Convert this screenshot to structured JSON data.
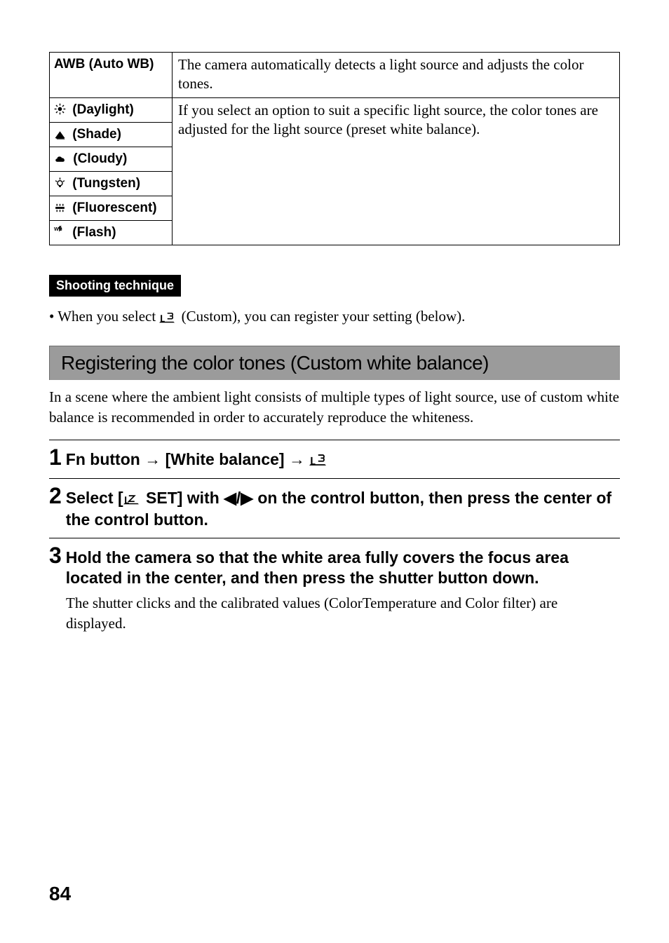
{
  "table": {
    "rows": [
      {
        "label": "AWB (Auto WB)",
        "icon": "none"
      },
      {
        "label": "(Daylight)",
        "icon": "sun"
      },
      {
        "label": "(Shade)",
        "icon": "shade"
      },
      {
        "label": "(Cloudy)",
        "icon": "cloud"
      },
      {
        "label": "(Tungsten)",
        "icon": "tungsten"
      },
      {
        "label": "(Fluorescent)",
        "icon": "fluorescent"
      },
      {
        "label": "(Flash)",
        "icon": "flash"
      }
    ],
    "desc_auto": "The camera automatically detects a light source and adjusts the color tones.",
    "desc_preset": "If you select an option to suit a specific light source, the color tones are adjusted for the light source (preset white balance)."
  },
  "tech_label": "Shooting technique",
  "tech_bullet": "When you select       (Custom), you can register your setting (below).",
  "tech_bullet_prefix": "• When you select ",
  "tech_bullet_suffix": " (Custom), you can register your setting (below).",
  "section_heading": "Registering the color tones (Custom white balance)",
  "section_para": "In a scene where the ambient light consists of multiple types of light source, use of custom white balance is recommended in order to accurately reproduce the whiteness.",
  "steps": {
    "s1_pre": "Fn button ",
    "s1_mid": " [White balance] ",
    "s2_pre": "Select [",
    "s2_mid": " SET] with ",
    "s2_lr": "◀/▶",
    "s2_post": " on the control button, then press the center of the control button.",
    "s3": "Hold the camera so that the white area fully covers the focus area located in the center, and then press the shutter button down.",
    "s3_sub": "The shutter clicks and the calibrated values (ColorTemperature and Color filter) are displayed."
  },
  "page_number": "84"
}
